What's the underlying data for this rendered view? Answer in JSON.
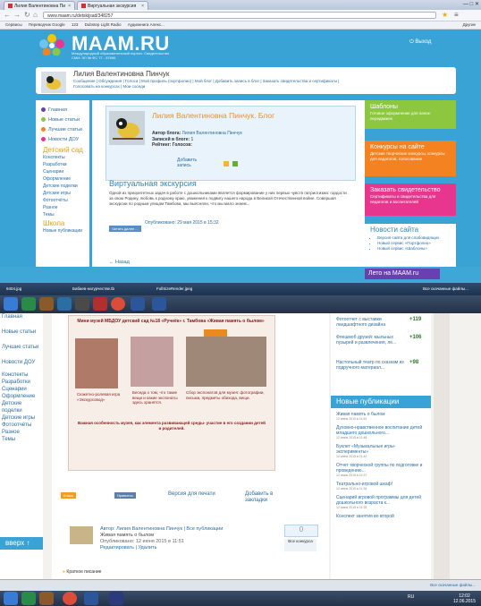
{
  "browser": {
    "tabs": [
      "Лилия Валентиновна Пи",
      "Виртуальная экскурсия"
    ],
    "window_controls": "— □ ✕",
    "address": "www.maam.ru/detskijsad/348257",
    "bookmarks": [
      "Сервисы",
      "Переводчик Google",
      "123",
      "Dubstep Light Radio",
      "Аудиокнига Алекс..."
    ],
    "bookmarks_right": "Другие"
  },
  "site": {
    "logo": "MAAM.RU",
    "logo_sub": "Международный образовательный портал. Свидетельство СМИ: ЭЛ № ФС 77 - 57696",
    "exit": "Выход",
    "user_name": "Лилия Валентиновна Пинчук",
    "user_links": "Сообщения | Обсуждения | Голоса | Мой профиль (портфолио) | Мой блог | Добавить запись в блог | Заказать свидетельства и сертификаты | Голосовать на конкурсах | Мои соседи"
  },
  "left_nav": {
    "items": [
      "Главная",
      "Новые статьи",
      "Лучшие статьи",
      "Новости ДОУ"
    ],
    "section_title": "Детский сад",
    "section_items": [
      "Конспекты",
      "Разработки",
      "Сценарии",
      "Оформление",
      "Детские поделки",
      "Детские игры",
      "Фотоотчёты",
      "Разное",
      "Темы"
    ],
    "school_title": "Школа",
    "school_items": [
      "Новые публикации"
    ]
  },
  "blog": {
    "title": "Лилия Валентиновна Пинчук. Блог",
    "author_label": "Автор блога:",
    "author": "Лилия Валентиновна Пинчук",
    "posts_label": "Записей в блоге:",
    "posts": "1",
    "rating_label": "Рейтинг:",
    "votes_label": "Голосов:",
    "add_post": "Добавить запись"
  },
  "article": {
    "title": "Виртуальная экскурсия",
    "text": "Одной из приоритетных задач в работе с дошкольниками является формирование у них первых чувств патриотизма: гордости за свою Родину, любовь к родному краю, уважения к подвигу нашего народа в Великой Отечественной войне. Совершая экскурсии по родным улицам Тамбова, мы выясняли, что мы мало знаем...",
    "read_more": "Читать далее ...",
    "published": "Опубликовано: 29 мая 2015 в 15:32",
    "back": "← Назад"
  },
  "right_boxes": [
    {
      "title": "Шаблоны",
      "desc": "Готовое оформление для папок-передвижек",
      "color": "#8dc63f"
    },
    {
      "title": "Конкурсы на сайте",
      "desc": "Детские творческие конкурсы, конкурсы для педагогов, голосование",
      "color": "#f58220"
    },
    {
      "title": "Заказать свидетельство",
      "desc": "Сертификаты и свидетельства для педагогов и воспитателей",
      "color": "#e8368f"
    }
  ],
  "news": {
    "title": "Новости сайта",
    "items": [
      "Версия сайта для слабовидящих",
      "Новый сервис «Портфолио»",
      "Новый сервис «Шаблоны»"
    ],
    "footer_link": "Лето на MAAM.ru"
  },
  "taskbar1": {
    "downloads": [
      "9404.jpg",
      "Бабаев-нагурчестве.tb",
      "FullSizeRender.jpeg"
    ],
    "all_downloads": "Все скачанные файлы..."
  },
  "shot2": {
    "left_nav": [
      "Главная",
      "Новые статьи",
      "Лучшие статьи",
      "Новости ДОУ",
      "Конспекты",
      "Разработки",
      "Сценарии",
      "Оформление",
      "Детские поделки",
      "Детские игры",
      "Фотоотчёты",
      "Разное",
      "Темы"
    ],
    "up_button": "вверх ↑",
    "photo_header": "Мини музей МБДОУ детский сад №18 «Ручеёк» г. Тамбова «Живая память о былом»",
    "caption1": "Сюжетно-ролевая игра «Экскурсовод»",
    "caption2": "Беседа о том, что такие вещи и какие экспонаты здесь хранятся.",
    "caption3": "Сбор экспонатов для музея: фотографии, письма, предметы обихода, вещи.",
    "caption4": "Важная особенность музея, как элемента развивающей среды- участие в его создании детей и родителей.",
    "social1": "Класс",
    "social2": "Нравится",
    "print": "Версия для печати",
    "add_bookmark": "Добавить в закладки",
    "author": "Автор: Лилия Валентиновна Пинчук | Все публикации",
    "post_title": "Живая память о былом",
    "post_date": "Опубликовано: 12 июня 2015 в 11:51",
    "post_actions": "Редактировать | Удалить",
    "score": "0",
    "contest": "Все конкурса",
    "short_desc": "Краткое писание"
  },
  "hot": [
    {
      "title": "Фотоотчет с выставки ландшафтного дизайна",
      "num": "+119"
    },
    {
      "title": "Флешмоб друзей: мыльных пузырей и развлечения, ле...",
      "num": "+106"
    },
    {
      "title": "Настольный театр по сказкам из подручного материал...",
      "num": "+98"
    }
  ],
  "new_pubs": {
    "title": "Новые публикации",
    "items": [
      {
        "title": "Живая память о былом",
        "date": "12 июня 2015 в 11:51"
      },
      {
        "title": "Духовно-нравственное воспитание детей младшего дошкольного...",
        "date": "12 июня 2015 в 11:48"
      },
      {
        "title": "Буклет «Музыкальные игры-эксперименты»",
        "date": "12 июня 2015 в 11:42"
      },
      {
        "title": "Отчет творческой группы по подготовке и проведению...",
        "date": "12 июня 2015 в 11:37"
      },
      {
        "title": "Театрально-игровой шкаф!",
        "date": "12 июня 2015 в 11:34"
      },
      {
        "title": "Сценарий игровой программы для детей дошкольного возраста к...",
        "date": "12 июня 2015 в 11:25"
      },
      {
        "title": "Конспект занятия во второй",
        "date": ""
      }
    ]
  },
  "taskbar2": {
    "lang": "RU",
    "time": "12:02",
    "date": "12.06.2015",
    "all_downloads": "Все скачанные файлы..."
  }
}
